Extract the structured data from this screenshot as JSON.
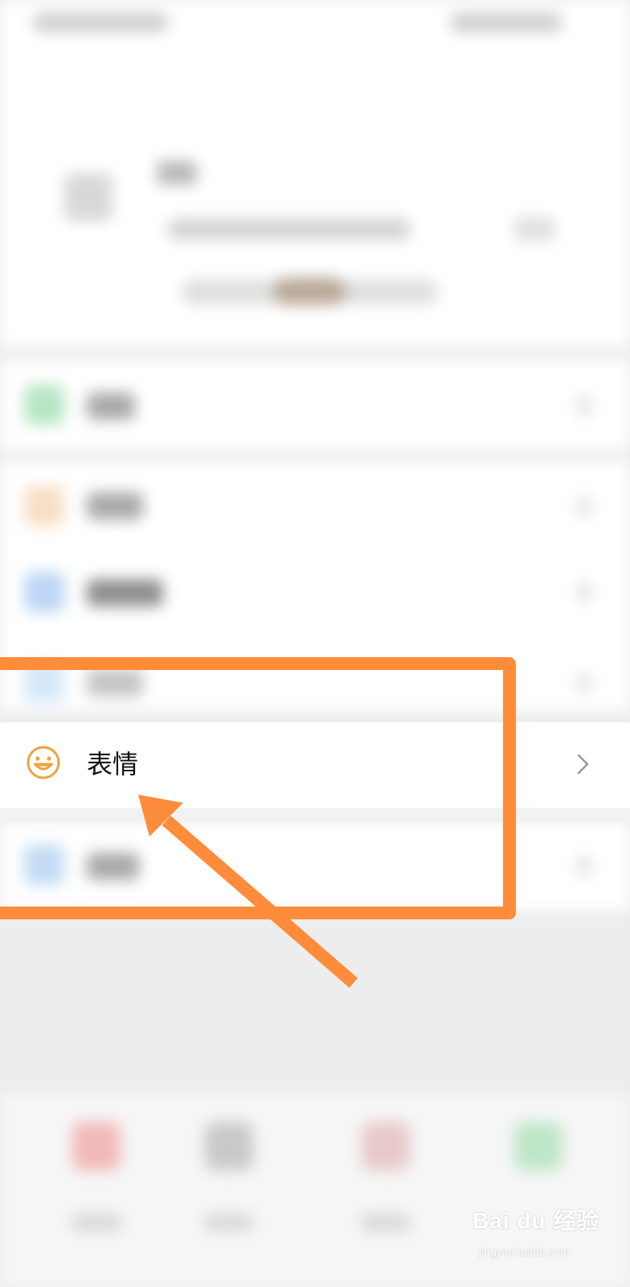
{
  "settings_list": {
    "emoji_item": {
      "label": "表情",
      "icon": "smiley-face-icon",
      "icon_color": "#f0a33a",
      "chevron": "chevron-right-icon"
    }
  },
  "annotation": {
    "color": "#ff8c3a",
    "box": "highlight-box",
    "arrow": "pointer-arrow"
  },
  "watermark": {
    "brand": "Bai du 经验",
    "site": "jingyan.baidu.com"
  }
}
